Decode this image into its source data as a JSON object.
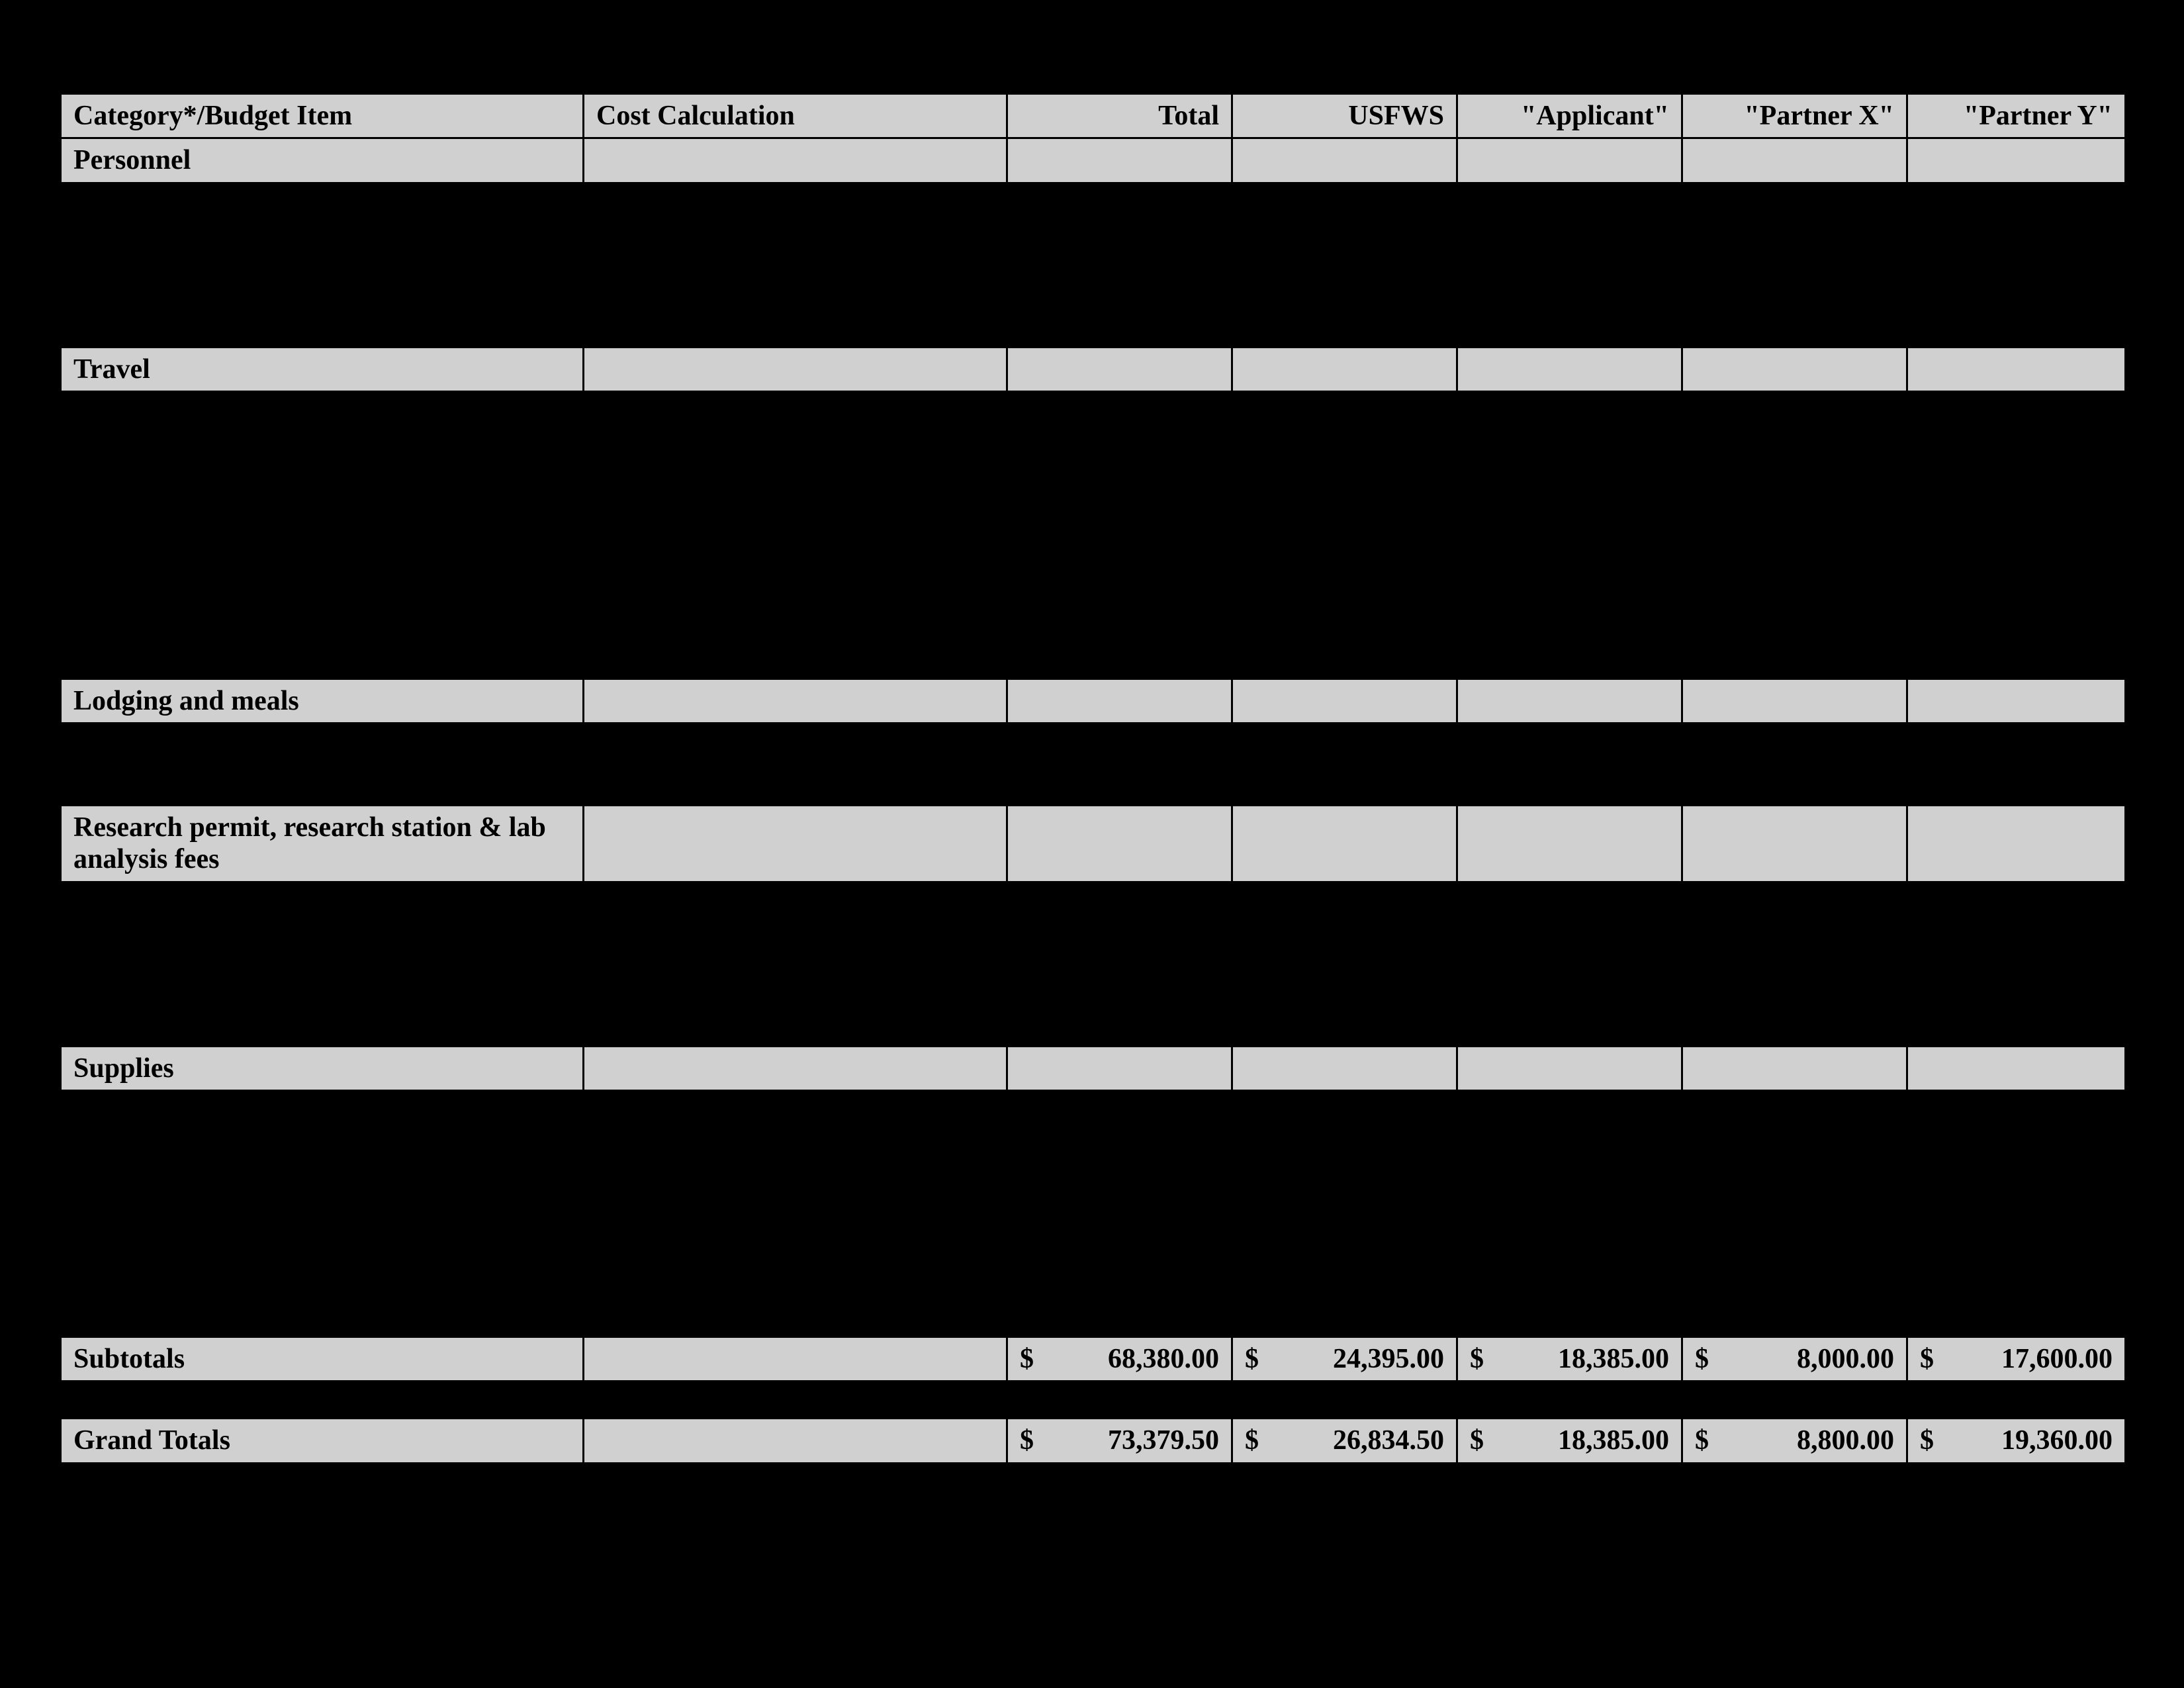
{
  "columns": {
    "c1": "Category*/Budget Item",
    "c2": "Cost Calculation",
    "c3": "Total",
    "c4": "USFWS",
    "c5": "\"Applicant\"",
    "c6": "\"Partner X\"",
    "c7": "\"Partner Y\""
  },
  "currency": "$",
  "sections": {
    "personnel": {
      "label": "Personnel",
      "blank_rows": 4
    },
    "travel": {
      "label": "Travel",
      "blank_rows": 7
    },
    "lodging": {
      "label": "Lodging and meals",
      "blank_rows": 2
    },
    "research": {
      "label": "Research permit, research station & lab analysis fees",
      "blank_rows": 4
    },
    "supplies": {
      "label": "Supplies",
      "blank_rows": 6
    }
  },
  "subtotals": {
    "label": "Subtotals",
    "total": "68,380.00",
    "usfws": "24,395.00",
    "applicant": "18,385.00",
    "partner_x": "8,000.00",
    "partner_y": "17,600.00"
  },
  "grand_totals": {
    "label": "Grand Totals",
    "total": "73,379.50",
    "usfws": "26,834.50",
    "applicant": "18,385.00",
    "partner_x": "8,800.00",
    "partner_y": "19,360.00"
  }
}
